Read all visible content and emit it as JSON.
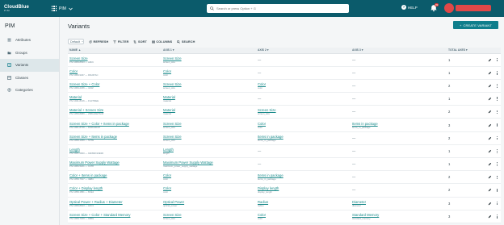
{
  "topbar": {
    "logo_text": "CloudBlue",
    "logo_sub": "PIM",
    "app_name": "PIM",
    "search_placeholder": "Search or press Option + G",
    "help_label": "HELP",
    "notification_count": "99"
  },
  "sidebar": {
    "title": "PIM",
    "items": [
      {
        "label": "Attributes",
        "icon": "attributes-icon",
        "active": false
      },
      {
        "label": "Groups",
        "icon": "folder-icon",
        "active": false
      },
      {
        "label": "Variants",
        "icon": "variants-icon",
        "active": true
      },
      {
        "label": "Classes",
        "icon": "classes-icon",
        "active": false
      },
      {
        "label": "Categories",
        "icon": "categories-icon",
        "active": false
      }
    ]
  },
  "main": {
    "title": "Variants",
    "create_label": "CREATE VARIANT",
    "toolbar": {
      "select_value": "Default",
      "refresh": "REFRESH",
      "filter": "FILTER",
      "sort": "SORT",
      "columns": "COLUMNS",
      "search": "SEARCH"
    },
    "columns": [
      "NAME",
      "AXIS 1",
      "AXIS 2",
      "AXIS 3",
      "TOTAL AXES"
    ],
    "rows": [
      {
        "name": "Screen Size",
        "id": "PIV-1068-8633 — A8K9",
        "a1": "Screen Size",
        "a1s": "screen_size",
        "a2": "—",
        "a2s": "",
        "a3": "—",
        "a3s": "",
        "total": "1"
      },
      {
        "name": "Color",
        "id": "PIV-1068-9467 — R9H3TAC",
        "a1": "Color",
        "a1s": "color",
        "a2": "—",
        "a2s": "",
        "a3": "—",
        "a3s": "",
        "total": "1"
      },
      {
        "name": "Screen Size + Color",
        "id": "PIV-1069-2236 — 4A3Z",
        "a1": "Screen Size",
        "a1s": "screen_size",
        "a2": "Color",
        "a2s": "color",
        "a3": "—",
        "a3s": "",
        "total": "2"
      },
      {
        "name": "Material",
        "id": "PIV-1041-8136 — FG37MEE",
        "a1": "Material",
        "a1s": "material",
        "a2": "—",
        "a2s": "",
        "a3": "—",
        "a3s": "",
        "total": "1"
      },
      {
        "name": "Material + Screen Size",
        "id": "PIV-1058-8089 — 298G3AETAC8",
        "a1": "Material",
        "a1s": "material",
        "a2": "Screen Size",
        "a2s": "screen_size",
        "a3": "—",
        "a3s": "",
        "total": "2"
      },
      {
        "name": "Screen Size + Color + Items in package",
        "id": "PIV-1061-8738 — R4RC2DCP",
        "a1": "Screen Size",
        "a1s": "screen_size",
        "a2": "Color",
        "a2s": "color",
        "a3": "Items in package",
        "a3s": "items_in_package",
        "total": "3"
      },
      {
        "name": "Screen Size + Items in package",
        "id": "PIV-1058-1299 — S7XE",
        "a1": "Screen Size",
        "a1s": "screen_size",
        "a2": "Items in package",
        "a2s": "items_in_package",
        "a3": "—",
        "a3s": "",
        "total": "2"
      },
      {
        "name": "Length",
        "id": "PIV-1021-2900 — 9AFB2D10E3D",
        "a1": "Length",
        "a1s": "length",
        "a2": "—",
        "a2s": "",
        "a3": "—",
        "a3s": "",
        "total": "1"
      },
      {
        "name": "Maximum Power Supply Wattage",
        "id": "PIV-1066-5221 — C4T8",
        "a1": "Maximum Power Supply Wattage",
        "a1s": "maximum_power_supply_wattage",
        "a2": "—",
        "a2s": "",
        "a3": "—",
        "a3s": "",
        "total": "1"
      },
      {
        "name": "Color + Items in package",
        "id": "PIV-1058-7917 — 4EBC",
        "a1": "Color",
        "a1s": "color",
        "a2": "Items in package",
        "a2s": "items_in_package",
        "a3": "—",
        "a3s": "",
        "total": "2"
      },
      {
        "name": "Color + Display length",
        "id": "PIV-1058-1581 — 8CE2",
        "a1": "Color",
        "a1s": "color",
        "a2": "Display length",
        "a2s": "display_length",
        "a3": "—",
        "a3s": "",
        "total": "2"
      },
      {
        "name": "Optical Power + Radius + Diameter",
        "id": "PIV-1068-8643 — A4C3",
        "a1": "Optical Power",
        "a1s": "optical_power",
        "a2": "Radius",
        "a2s": "radius",
        "a3": "Diameter",
        "a3s": "diameter",
        "total": "3"
      },
      {
        "name": "Screen Size + Color + Standard Memory",
        "id": "PIV-1068-7229 — 94BG",
        "a1": "Screen Size",
        "a1s": "screen_size",
        "a2": "Color",
        "a2s": "color",
        "a3": "Standard Memory",
        "a3s": "standard_memory",
        "total": "3"
      }
    ]
  },
  "colors": {
    "topbar": "#0b5b6b",
    "accent": "#0f7e8c",
    "link": "#1a8b8b"
  }
}
